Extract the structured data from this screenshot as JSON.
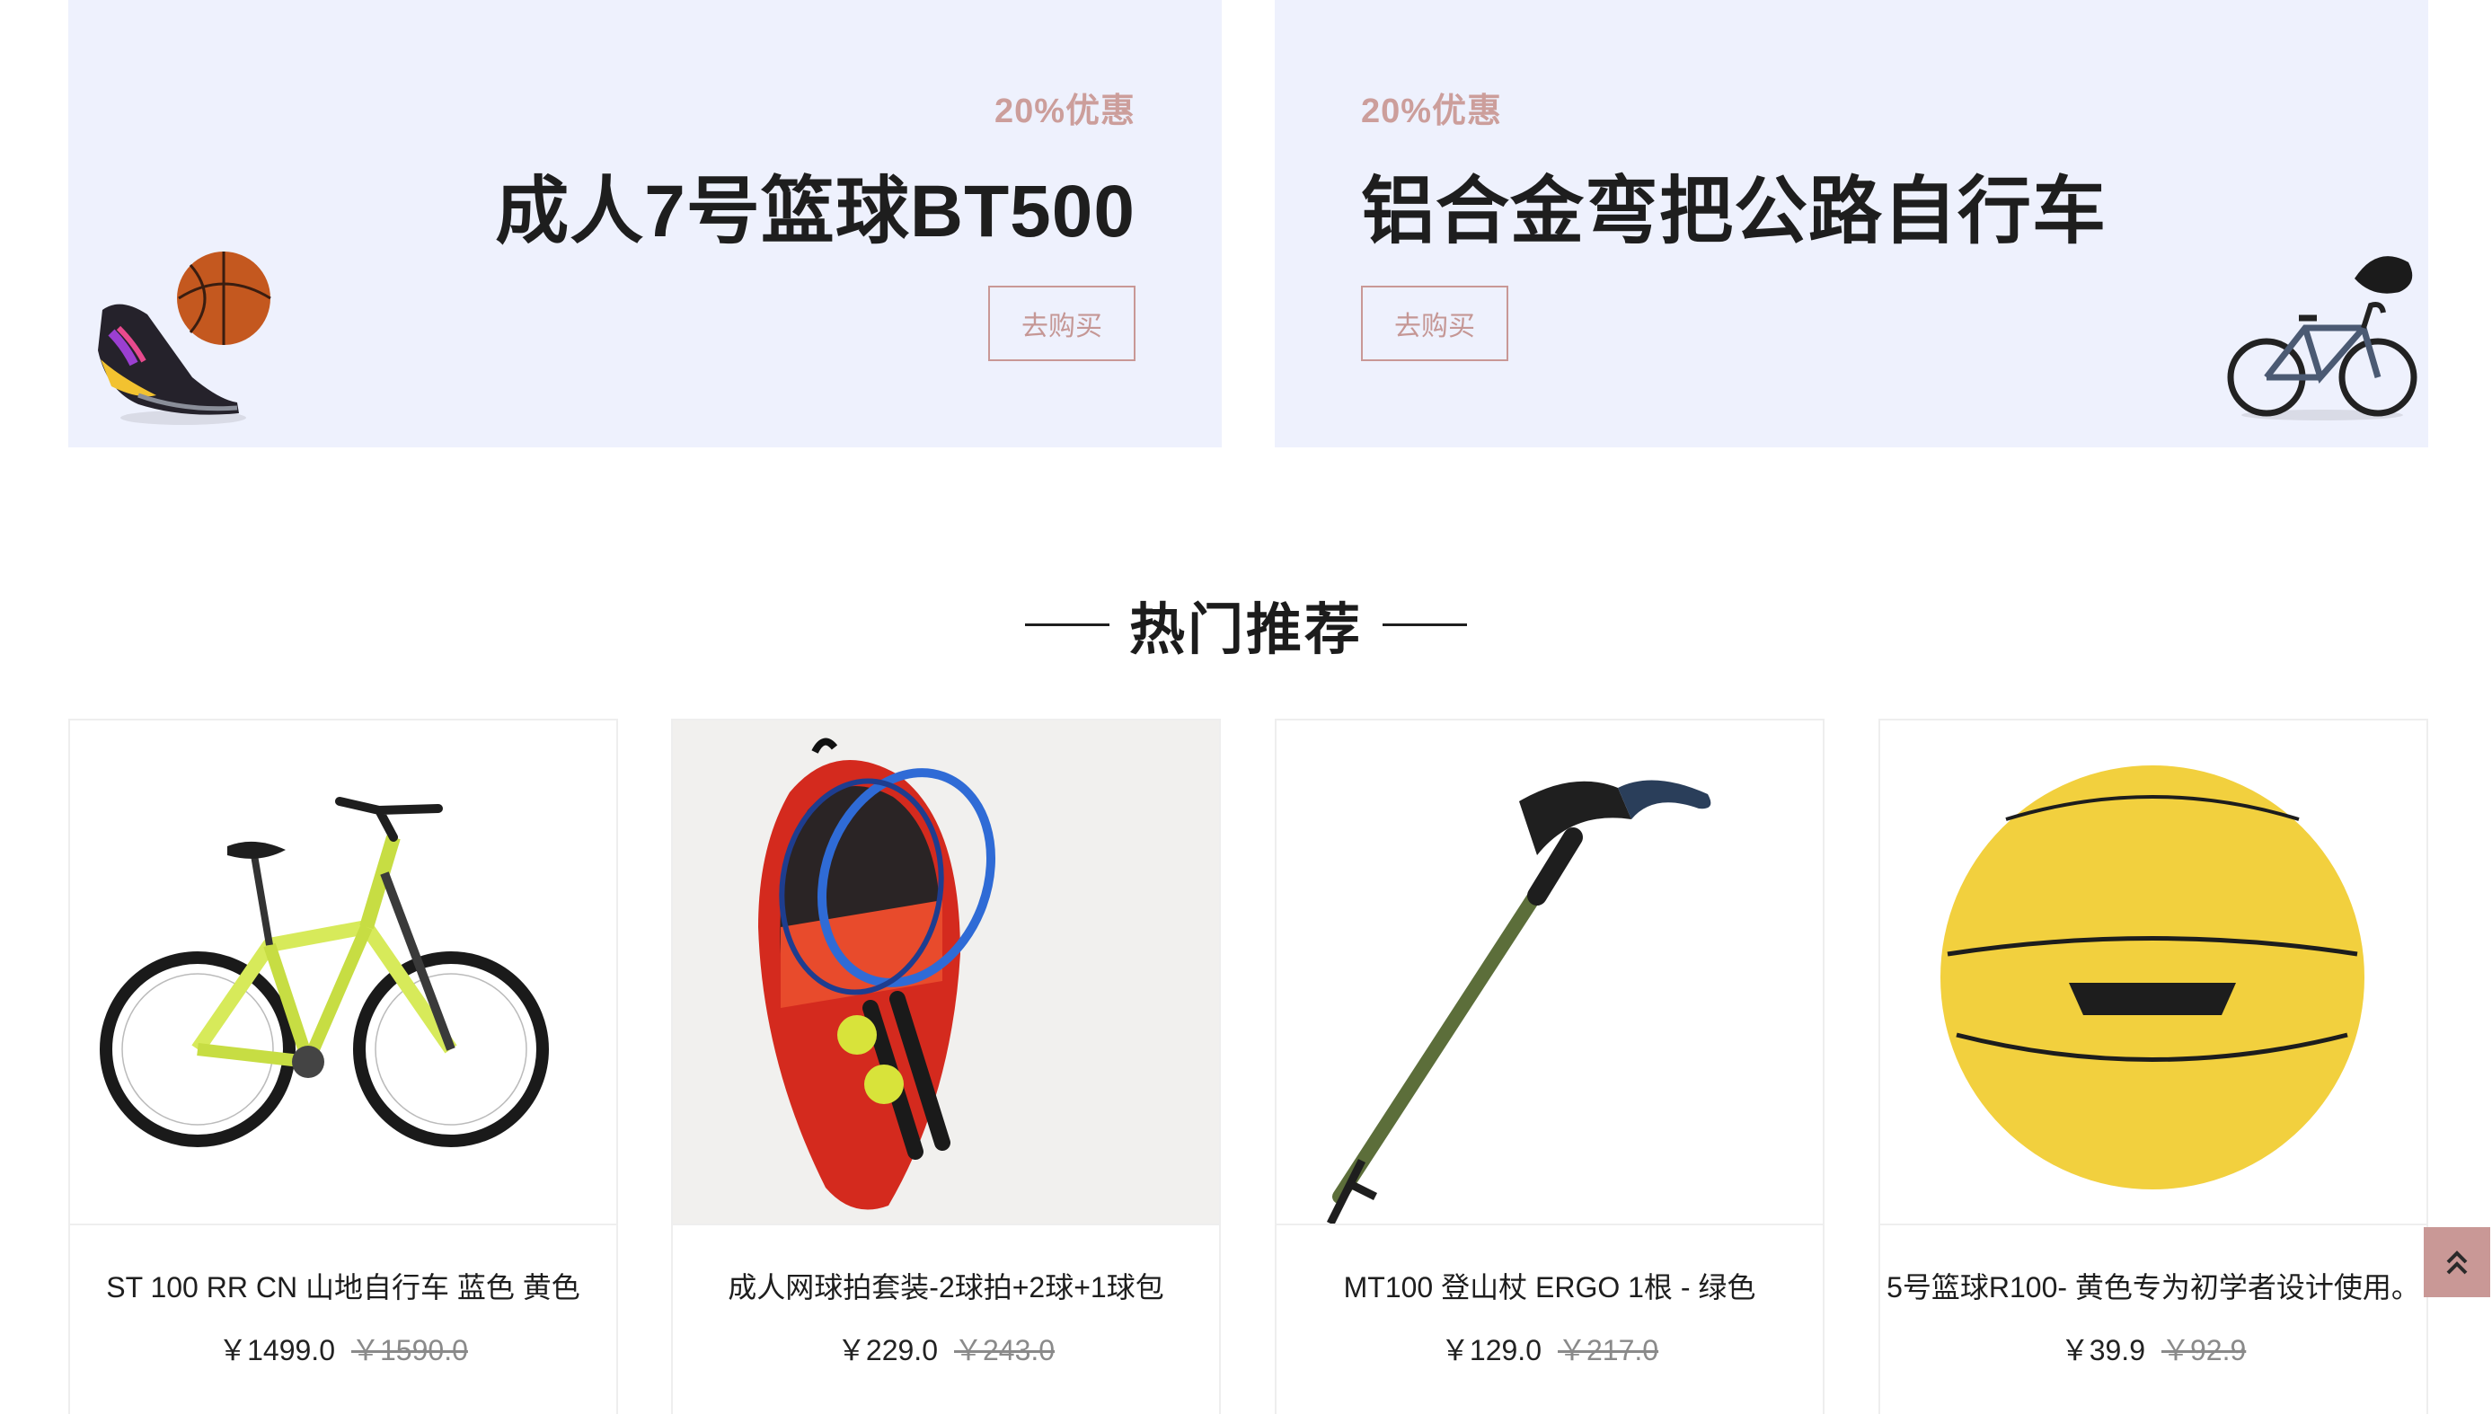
{
  "promos": [
    {
      "discount": "20%优惠",
      "title": "成人7号篮球BT500",
      "button": "去购买",
      "icon": "basketball-shoe-image"
    },
    {
      "discount": "20%优惠",
      "title": "铝合金弯把公路自行车",
      "button": "去购买",
      "icon": "road-bike-image"
    }
  ],
  "section": {
    "title": "热门推荐"
  },
  "products": [
    {
      "name": "ST 100 RR CN 山地自行车 蓝色 黄色",
      "price": "￥1499.0",
      "old_price": "￥1590.0",
      "icon": "mountain-bike-image"
    },
    {
      "name": "成人网球拍套装-2球拍+2球+1球包",
      "price": "￥229.0",
      "old_price": "￥243.0",
      "icon": "tennis-set-image"
    },
    {
      "name": "MT100 登山杖 ERGO 1根 - 绿色",
      "price": "￥129.0",
      "old_price": "￥217.0",
      "icon": "trekking-pole-image"
    },
    {
      "name": "5号篮球R100- 黄色专为初学者设计使用。",
      "price": "￥39.9",
      "old_price": "￥92.9",
      "icon": "yellow-basketball-image"
    }
  ],
  "colors": {
    "accent": "#c99896",
    "banner_bg": "#eef1fd"
  },
  "back_to_top": {
    "icon": "double-chevron-up-icon"
  }
}
